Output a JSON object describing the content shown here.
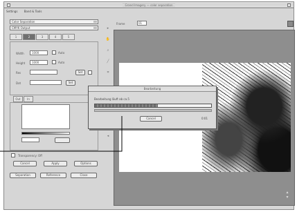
{
  "window": {
    "title": "Grand Imagery — color separation"
  },
  "menubar": {
    "items": [
      "Settings",
      "Band & Tools"
    ]
  },
  "left_panel": {
    "popup_1": "Color Separation",
    "popup_2": "CMYK Output",
    "tabs": [
      "1",
      "2",
      "3",
      "4",
      "5"
    ],
    "field_labels": [
      "Width",
      "Height",
      "Res",
      "Dot"
    ],
    "field_values": [
      "1000",
      "1000",
      "",
      ""
    ],
    "checkbox_labels": [
      "Auto",
      "Auto"
    ],
    "small_buttons": [
      "Set",
      "Set"
    ],
    "group_tabs": [
      "Out",
      "In"
    ],
    "bottom_label": "Transparency: Off",
    "row_buttons": [
      "Cancel",
      "Apply",
      "Options"
    ],
    "footer_buttons": [
      "Separation",
      "Reference",
      "Close"
    ]
  },
  "preview": {
    "label": "Frame",
    "value": "01"
  },
  "dialog": {
    "title": "Bearbeitung",
    "message": "Bearbeitung läuft ab ca.5",
    "progress": 0.54,
    "button": "Cancel",
    "percent_text": "0:01"
  },
  "colors": {
    "window_bg": "#d6d6d6",
    "preview_bg": "#8e8e8e",
    "dialog_bg": "#d9d9d9",
    "progress_fill": "#6b6b6b"
  },
  "icons": [
    "arrow-tool-icon",
    "hand-tool-icon",
    "zoom-tool-icon",
    "eyedropper-tool-icon",
    "crop-tool-icon",
    "scroll-arrows-icon"
  ]
}
